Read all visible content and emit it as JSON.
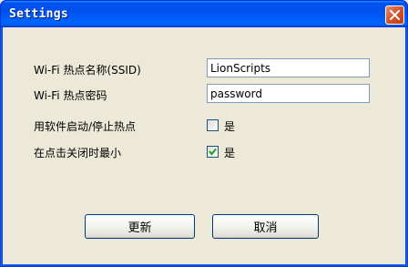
{
  "window": {
    "title": "Settings"
  },
  "form": {
    "ssid_label": "Wi-Fi 热点名称(SSID)",
    "ssid_value": "LionScripts",
    "password_label": "Wi-Fi 热点密码",
    "password_value": "password",
    "toggle_label": "用软件启动/停止热点",
    "toggle_option": "是",
    "toggle_checked": false,
    "minimize_label": "在点击关闭时最小",
    "minimize_option": "是",
    "minimize_checked": true
  },
  "buttons": {
    "update_label": "更新",
    "cancel_label": "取消"
  },
  "colors": {
    "titlebar": "#0054e3",
    "dialog_bg": "#ece9d8",
    "close_button": "#d4542a",
    "checkmark": "#21a121"
  }
}
